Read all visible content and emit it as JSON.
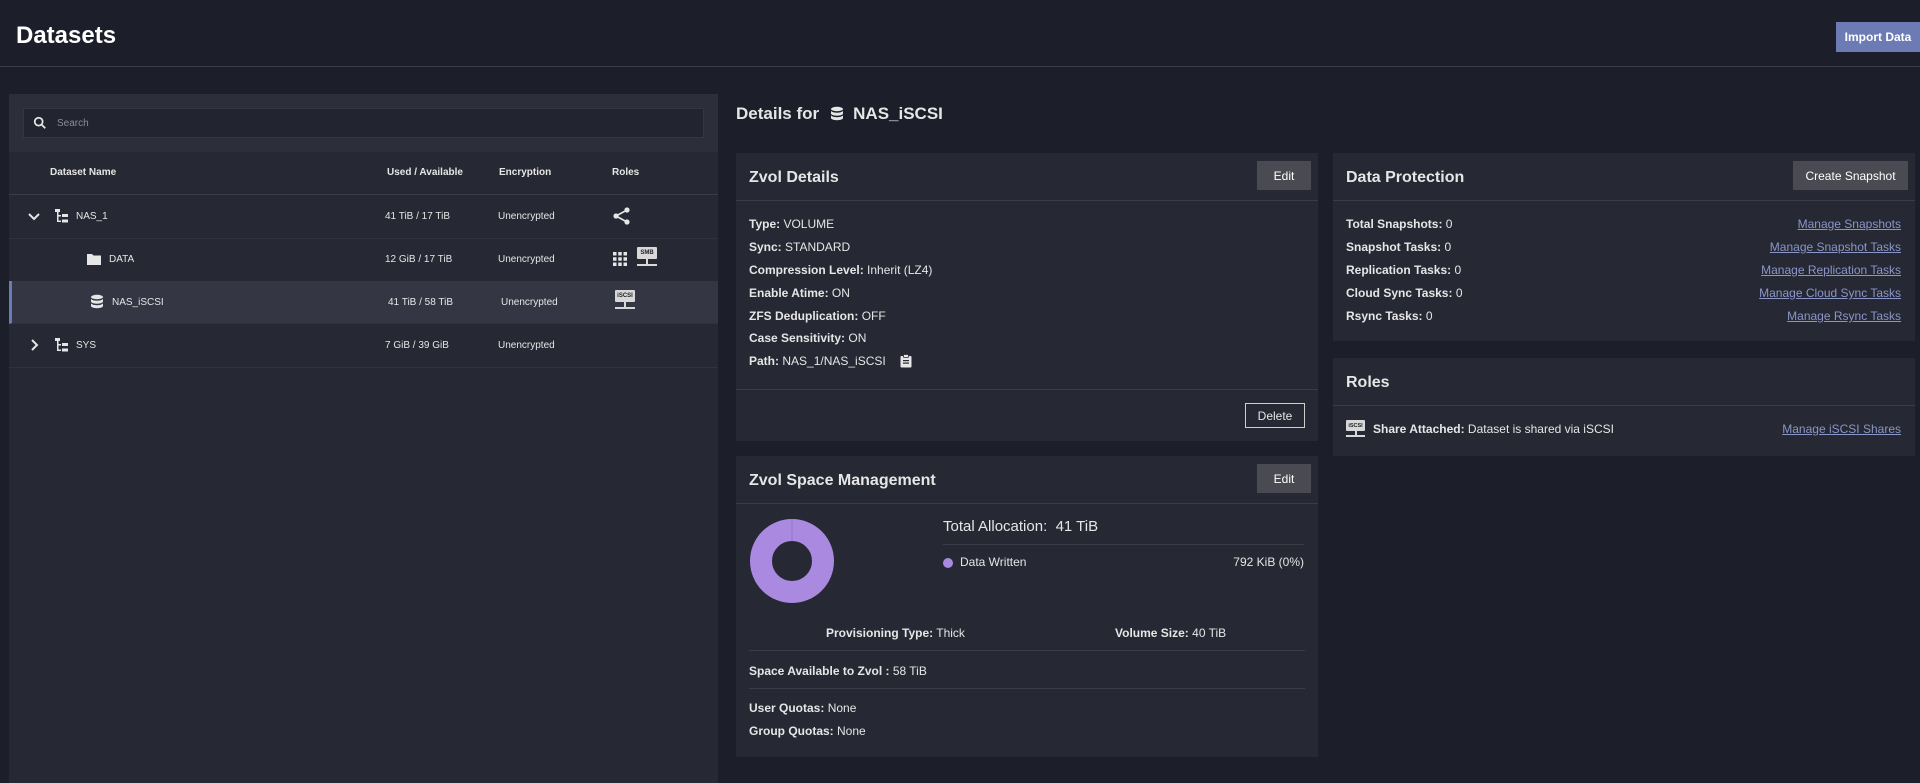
{
  "header": {
    "title": "Datasets",
    "import_label": "Import Data"
  },
  "search": {
    "placeholder": "Search"
  },
  "table": {
    "columns": [
      "Dataset Name",
      "Used / Available",
      "Encryption",
      "Roles"
    ],
    "rows": [
      {
        "name": "NAS_1",
        "used": "41 TiB / 17 TiB",
        "encryption": "Unencrypted"
      },
      {
        "name": "DATA",
        "used": "12 GiB / 17 TiB",
        "encryption": "Unencrypted",
        "smb": "SMB"
      },
      {
        "name": "NAS_iSCSI",
        "used": "41 TiB / 58 TiB",
        "encryption": "Unencrypted",
        "iscsi": "iSCSI"
      },
      {
        "name": "SYS",
        "used": "7 GiB / 39 GiB",
        "encryption": "Unencrypted"
      }
    ]
  },
  "details": {
    "prefix": "Details for",
    "dataset": "NAS_iSCSI"
  },
  "zvol_details": {
    "title": "Zvol Details",
    "edit_label": "Edit",
    "delete_label": "Delete",
    "items": [
      {
        "key": "Type:",
        "value": "VOLUME"
      },
      {
        "key": "Sync:",
        "value": "STANDARD"
      },
      {
        "key": "Compression Level:",
        "value": "Inherit (LZ4)"
      },
      {
        "key": "Enable Atime:",
        "value": "ON"
      },
      {
        "key": "ZFS Deduplication:",
        "value": "OFF"
      },
      {
        "key": "Case Sensitivity:",
        "value": "ON"
      },
      {
        "key": "Path:",
        "value": "NAS_1/NAS_iSCSI"
      }
    ]
  },
  "space": {
    "title": "Zvol Space Management",
    "edit_label": "Edit",
    "total_label": "Total Allocation:",
    "total_value": "41 TiB",
    "legend_label": "Data Written",
    "legend_value": "792 KiB (0%)",
    "legend_color": "#a98ae0",
    "provisioning_key": "Provisioning Type:",
    "provisioning_value": "Thick",
    "volume_key": "Volume Size:",
    "volume_value": "40 TiB",
    "available_key": "Space Available to Zvol :",
    "available_value": "58 TiB",
    "user_quota_key": "User Quotas:",
    "user_quota_value": "None",
    "group_quota_key": "Group Quotas:",
    "group_quota_value": "None"
  },
  "protection": {
    "title": "Data Protection",
    "create_label": "Create Snapshot",
    "items": [
      {
        "key": "Total Snapshots:",
        "value": "0",
        "link": "Manage Snapshots"
      },
      {
        "key": "Snapshot Tasks:",
        "value": "0",
        "link": "Manage Snapshot Tasks"
      },
      {
        "key": "Replication Tasks:",
        "value": "0",
        "link": "Manage Replication Tasks"
      },
      {
        "key": "Cloud Sync Tasks:",
        "value": "0",
        "link": "Manage Cloud Sync Tasks"
      },
      {
        "key": "Rsync Tasks:",
        "value": "0",
        "link": "Manage Rsync Tasks"
      }
    ]
  },
  "roles": {
    "title": "Roles",
    "icon_text": "iSCSI",
    "share_key": "Share Attached:",
    "share_value": "Dataset is shared via iSCSI",
    "link": "Manage iSCSI Shares"
  },
  "colors": {
    "accent": "#6c7bb3",
    "link": "#8a96c8",
    "background": "#1c1e29",
    "card": "#262833"
  }
}
